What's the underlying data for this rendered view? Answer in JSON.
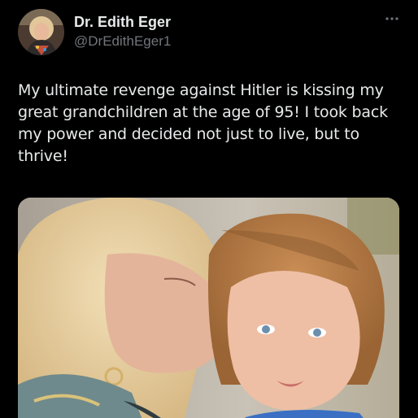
{
  "tweet": {
    "author": {
      "display_name": "Dr. Edith Eger",
      "handle": "@DrEdithEger1",
      "avatar_icon": "profile-photo"
    },
    "more_icon": "more-horizontal-icon",
    "text": "My ultimate revenge against Hitler is kissing my great grandchildren at the age of 95! I took back my power and decided not just to live, but to thrive!",
    "media": {
      "type": "photo"
    }
  },
  "colors": {
    "background": "#000000",
    "primary_text": "#e7e9ea",
    "secondary_text": "#71767b"
  }
}
